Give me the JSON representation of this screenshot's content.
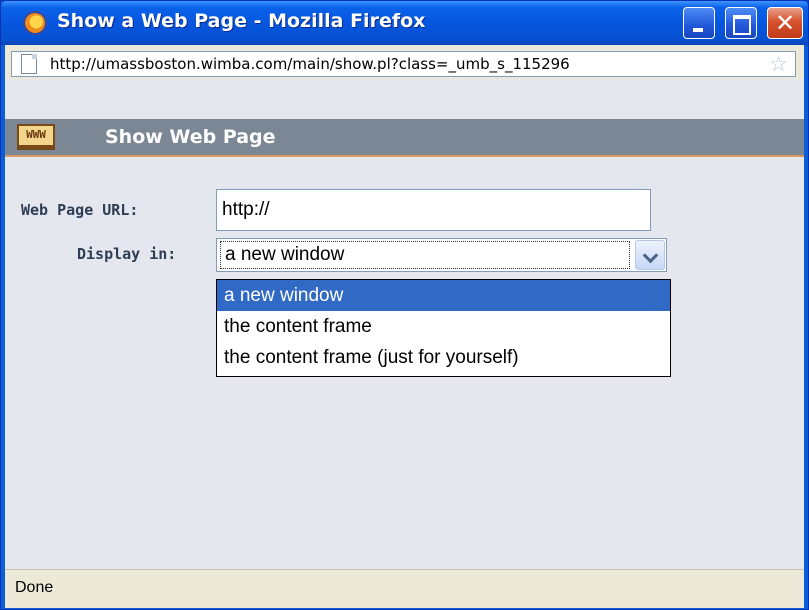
{
  "window": {
    "title": "Show a Web Page - Mozilla Firefox",
    "icon": "firefox-icon"
  },
  "urlbar": {
    "url": "http://umassboston.wimba.com/main/show.pl?class=_umb_s_115296",
    "page_icon": "page-icon",
    "bookmark_icon": "star-icon"
  },
  "page": {
    "heading": "Show Web Page",
    "header_icon_text": "WWW",
    "colors": {
      "header_bg": "#7b8794",
      "content_bg": "#e4e8ee",
      "selection": "#316ac5"
    }
  },
  "form": {
    "url_label": "Web Page URL:",
    "url_value": "http://",
    "display_label": "Display in:",
    "display_selected": "a new window",
    "display_options": [
      "a new window",
      "the content frame",
      "the content frame (just for yourself)"
    ]
  },
  "status": {
    "text": "Done"
  }
}
